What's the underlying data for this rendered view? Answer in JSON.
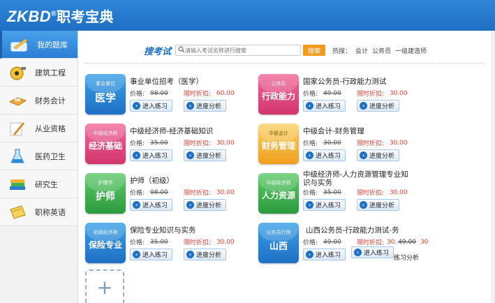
{
  "app": {
    "logo_latin": "ZKBD",
    "logo_reg": "®",
    "logo_cn": "职考宝典"
  },
  "sidebar": {
    "items": [
      {
        "label": "我的题库",
        "icon": "pen-book-icon"
      },
      {
        "label": "建筑工程",
        "icon": "measure-tape-icon"
      },
      {
        "label": "财务会计",
        "icon": "calculator-icon"
      },
      {
        "label": "从业资格",
        "icon": "pencil-note-icon"
      },
      {
        "label": "医药卫生",
        "icon": "flask-icon"
      },
      {
        "label": "研究生",
        "icon": "books-icon"
      },
      {
        "label": "职称英语",
        "icon": "notebook-icon"
      }
    ]
  },
  "search": {
    "title": "搜考试",
    "placeholder": "请输入考试名称进行搜索",
    "button": "搜索",
    "hot_label": "热搜：",
    "hot_items": [
      "会计",
      "公务员",
      "一级建造师"
    ]
  },
  "labels": {
    "price": "价格:",
    "discount": "限时折扣:",
    "practice": "进入练习",
    "analysis": "进度分析"
  },
  "cards": [
    {
      "title": "事业单位招考（医学）",
      "cover_small": "事业单位",
      "cover_big": "医学",
      "price": "98.00",
      "discount": "60.00",
      "color": "#2c8fd8"
    },
    {
      "title": "国家公务员-行政能力测试",
      "cover_small": "公务员",
      "cover_big": "行政能力",
      "price": "49.00",
      "discount": "30.00",
      "color": "#e0467d"
    },
    {
      "title": "中级经济师-经济基础知识",
      "cover_small": "中级经济师",
      "cover_big": "经济基础",
      "price": "35.00",
      "discount": "30.00",
      "color": "#e0467d"
    },
    {
      "title": "中级会计-财务管理",
      "cover_small": "中级会计",
      "cover_big": "财务管理",
      "price": "30.00",
      "discount": "30.00",
      "color": "#f2b233"
    },
    {
      "title": "护师（初级）",
      "cover_small": "护理学",
      "cover_big": "护师",
      "price": "98.00",
      "discount": "30.00",
      "color": "#3fb34f"
    },
    {
      "title": "中级经济师-人力资源管理专业知识与实务",
      "title_line1": "中级经济师-人力资源管理专业知",
      "title_line2": "识与实务",
      "cover_small": "中级经济师",
      "cover_big": "人力资源",
      "price": "35.00",
      "discount": "30.00",
      "color": "#3fb34f"
    },
    {
      "title": "保险专业知识与实务",
      "cover_small": "初级经济师",
      "cover_big": "保险专业",
      "price": "35.00",
      "discount": "30.00",
      "color": "#2c8fd8"
    },
    {
      "title": "山西公务员-行政能力测试-务",
      "cover_small": "公务员行测",
      "cover_big": "山西",
      "price": "49.00",
      "discount": "30.",
      "discount_overlap": "49.00",
      "discount_extra": "30",
      "color": "#2c8fd8"
    }
  ],
  "overlap": {
    "practice_ghost": "进入练习",
    "analysis_ghost": "练习分析"
  },
  "add_card": {
    "symbol": "+"
  }
}
